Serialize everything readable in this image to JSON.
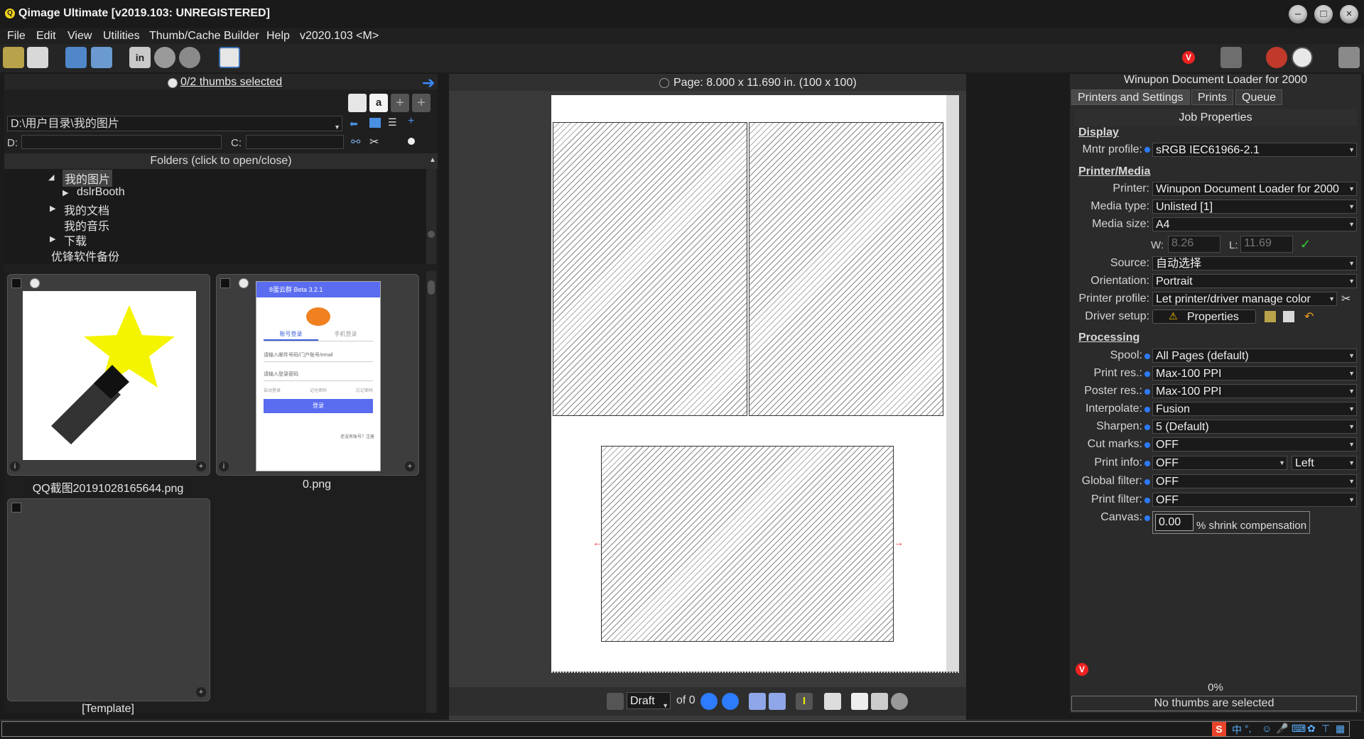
{
  "window": {
    "title": "Qimage Ultimate [v2019.103: UNREGISTERED]",
    "minimize": "–",
    "maximize": "□",
    "close": "×"
  },
  "menu": [
    "File",
    "Edit",
    "View",
    "Utilities",
    "Thumb/Cache Builder",
    "Help",
    "v2020.103 <M>"
  ],
  "left": {
    "thumbs_selected": "0/2 thumbs selected",
    "path": "D:\\用户目录\\我的图片",
    "d_label": "D:",
    "c_label": "C:",
    "folders_header": "Folders (click to open/close)",
    "folders": [
      {
        "label": "我的图片",
        "expanded": true,
        "selected": true
      },
      {
        "label": "dslrBooth",
        "arrow": true
      },
      {
        "label": "我的文档",
        "arrow": true
      },
      {
        "label": "我的音乐"
      },
      {
        "label": "下载",
        "arrow": true
      },
      {
        "label": "优锋软件备份"
      }
    ],
    "thumbs": [
      {
        "caption": "QQ截图20191028165644.png",
        "icon": "magic-wand-star"
      },
      {
        "caption": "0.png",
        "icon": "login-dialog",
        "dialog": {
          "title": "8蛋云群 Beta 3.2.1",
          "tab1": "账号登录",
          "tab2": "手机登录",
          "field1": "请输入邮件号码/门户账号/email",
          "field2": "请输入登录密码",
          "opt1": "自动登录",
          "opt2": "记住密码",
          "opt3": "忘记密码",
          "button": "登录",
          "footer": "还没有账号？注册"
        }
      },
      {
        "caption": "[Template]"
      }
    ]
  },
  "center": {
    "page_info": "Page: 8.000 x 11.690 in.  (100 x 100)",
    "mode": "Draft",
    "of_label": "of 0"
  },
  "right": {
    "title": "Winupon Document Loader for 2000",
    "tabs": [
      "Printers and Settings",
      "Prints",
      "Queue"
    ],
    "job_props": "Job Properties",
    "display_header": "Display",
    "mntr_label": "Mntr profile:",
    "mntr_value": "sRGB IEC61966-2.1",
    "printer_header": "Printer/Media",
    "printer_label": "Printer:",
    "printer_value": "Winupon Document Loader for 2000",
    "media_type_label": "Media type:",
    "media_type_value": "Unlisted [1]",
    "media_size_label": "Media size:",
    "media_size_value": "A4",
    "w_label": "W:",
    "w_value": "8.26",
    "l_label": "L:",
    "l_value": "11.69",
    "source_label": "Source:",
    "source_value": "自动选择",
    "orientation_label": "Orientation:",
    "orientation_value": "Portrait",
    "profile_label": "Printer profile:",
    "profile_value": "Let printer/driver manage color",
    "driver_label": "Driver setup:",
    "driver_button": "Properties",
    "processing_header": "Processing",
    "spool_label": "Spool:",
    "spool_value": "All Pages (default)",
    "print_res_label": "Print res.:",
    "print_res_value": "Max-100 PPI",
    "poster_res_label": "Poster res.:",
    "poster_res_value": "Max-100 PPI",
    "interpolate_label": "Interpolate:",
    "interpolate_value": "Fusion",
    "sharpen_label": "Sharpen:",
    "sharpen_value": "5 (Default)",
    "cut_marks_label": "Cut marks:",
    "cut_marks_value": "OFF",
    "print_info_label": "Print info:",
    "print_info_value": "OFF",
    "print_info_pos": "Left",
    "global_filter_label": "Global filter:",
    "global_filter_value": "OFF",
    "print_filter_label": "Print filter:",
    "print_filter_value": "OFF",
    "canvas_label": "Canvas:",
    "canvas_value": "0.00",
    "canvas_suffix": "% shrink compensation",
    "progress": "0%",
    "status": "No thumbs are selected"
  },
  "tray": {
    "ime": "中",
    "text": "°,"
  },
  "colors": {
    "accent": "#2d7bff",
    "red": "#e33333",
    "bg": "#1b1b1b"
  }
}
